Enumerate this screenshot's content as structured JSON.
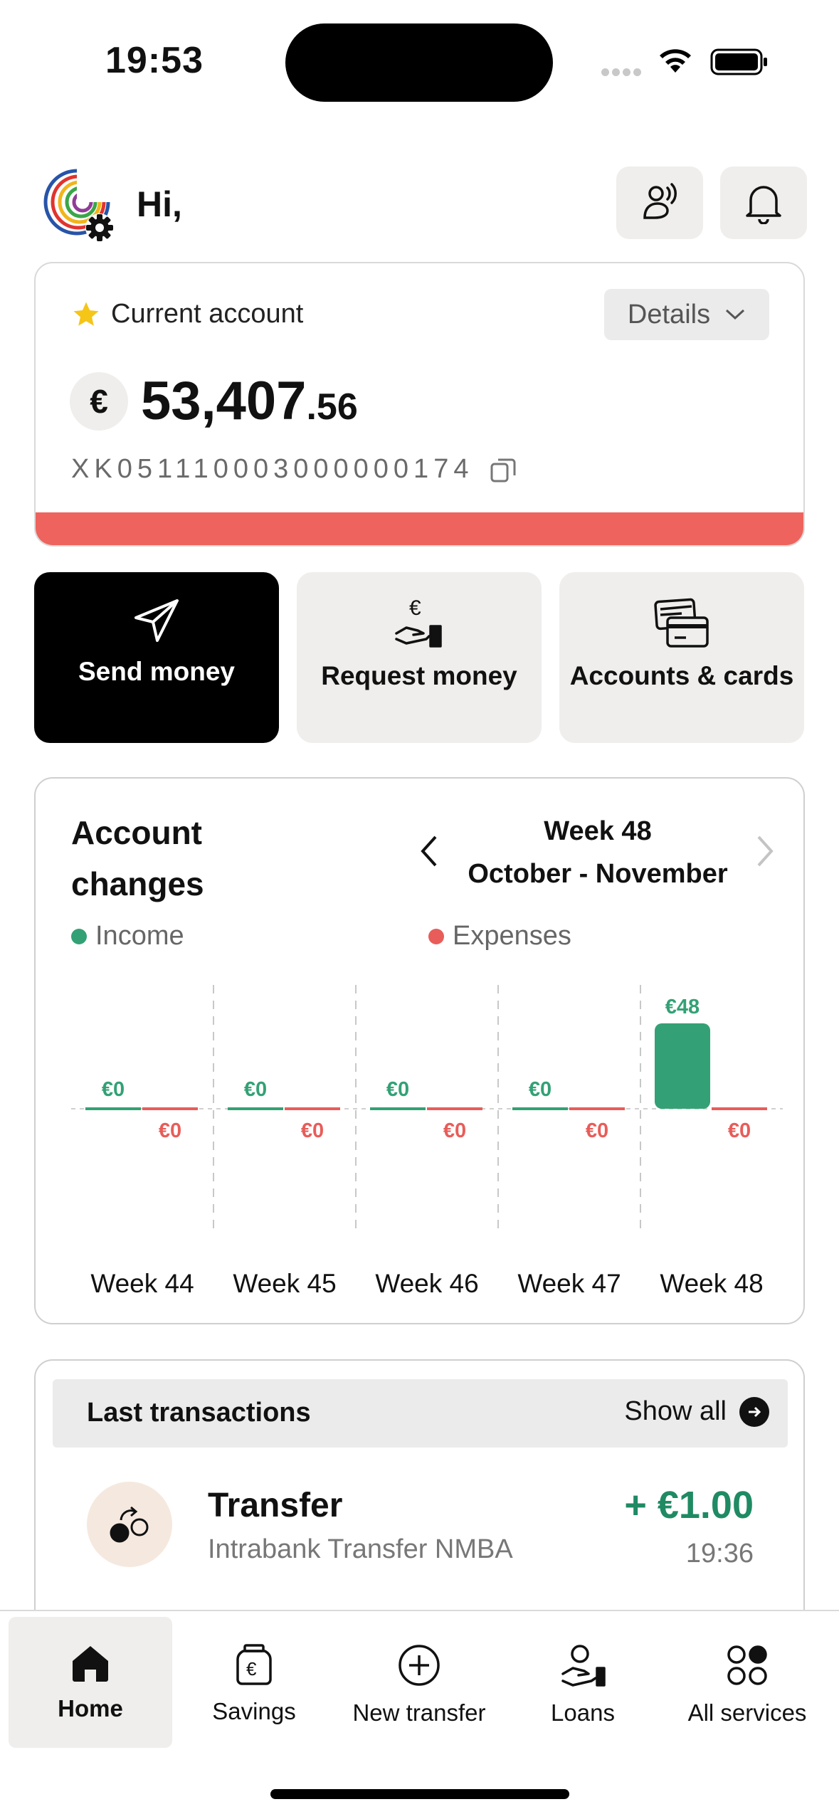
{
  "status_bar": {
    "time": "19:53"
  },
  "header": {
    "greeting": "Hi,"
  },
  "account": {
    "title": "Current account",
    "details_label": "Details",
    "currency_symbol": "€",
    "balance_int": "53,407",
    "balance_dec": ".56",
    "iban": "XK051110003000000174",
    "status_bar_color": "#ee635d"
  },
  "actions": {
    "send": "Send money",
    "request": "Request money",
    "accounts": "Accounts & cards"
  },
  "account_changes": {
    "title": "Account changes",
    "week_title": "Week 48",
    "week_range": "October - November",
    "legend_income": "Income",
    "legend_expenses": "Expenses",
    "income_color": "#33a175",
    "expense_color": "#e85d59"
  },
  "chart_data": {
    "type": "bar",
    "categories": [
      "Week 44",
      "Week 45",
      "Week 46",
      "Week 47",
      "Week 48"
    ],
    "series": [
      {
        "name": "Income",
        "values": [
          0,
          0,
          0,
          0,
          48
        ],
        "labels": [
          "€0",
          "€0",
          "€0",
          "€0",
          "€48"
        ]
      },
      {
        "name": "Expenses",
        "values": [
          0,
          0,
          0,
          0,
          0
        ],
        "labels": [
          "€0",
          "€0",
          "€0",
          "€0",
          "€0"
        ]
      }
    ]
  },
  "transactions": {
    "title": "Last transactions",
    "show_all": "Show all",
    "items": [
      {
        "name": "Transfer",
        "description": "Intrabank Transfer NMBA",
        "amount": "+ €1.00",
        "time": "19:36"
      }
    ]
  },
  "nav": {
    "home": "Home",
    "savings": "Savings",
    "new_transfer": "New transfer",
    "loans": "Loans",
    "all_services": "All services"
  }
}
